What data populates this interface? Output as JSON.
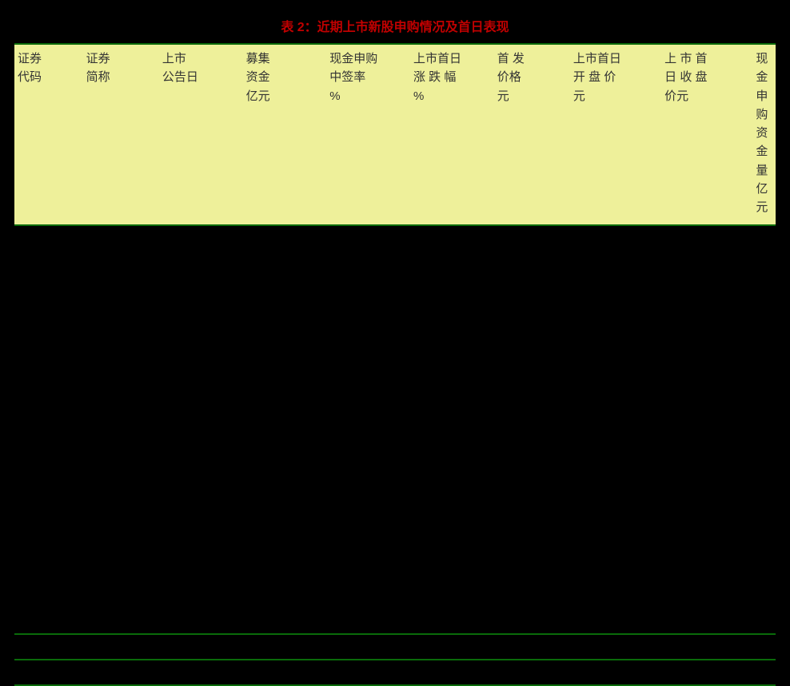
{
  "title": "表 2：近期上市新股申购情况及首日表现",
  "columns": [
    {
      "lines": [
        "证券",
        "代码"
      ]
    },
    {
      "lines": [
        "证券",
        "简称"
      ]
    },
    {
      "lines": [
        "上市",
        "公告日"
      ]
    },
    {
      "lines": [
        "募集",
        "资金",
        "亿元"
      ]
    },
    {
      "lines": [
        "现金申购",
        "中签率",
        "%"
      ]
    },
    {
      "lines": [
        "上市首日",
        "涨 跌 幅",
        "%"
      ]
    },
    {
      "lines": [
        "首 发",
        "价格",
        "元"
      ]
    },
    {
      "lines": [
        "上市首日",
        "开 盘 价",
        "元"
      ]
    },
    {
      "lines": [
        "上 市 首",
        "日 收 盘",
        "价元"
      ]
    },
    {
      "lines": [
        "现金申购",
        "资金量",
        "亿元"
      ]
    }
  ],
  "body_rows": 18
}
